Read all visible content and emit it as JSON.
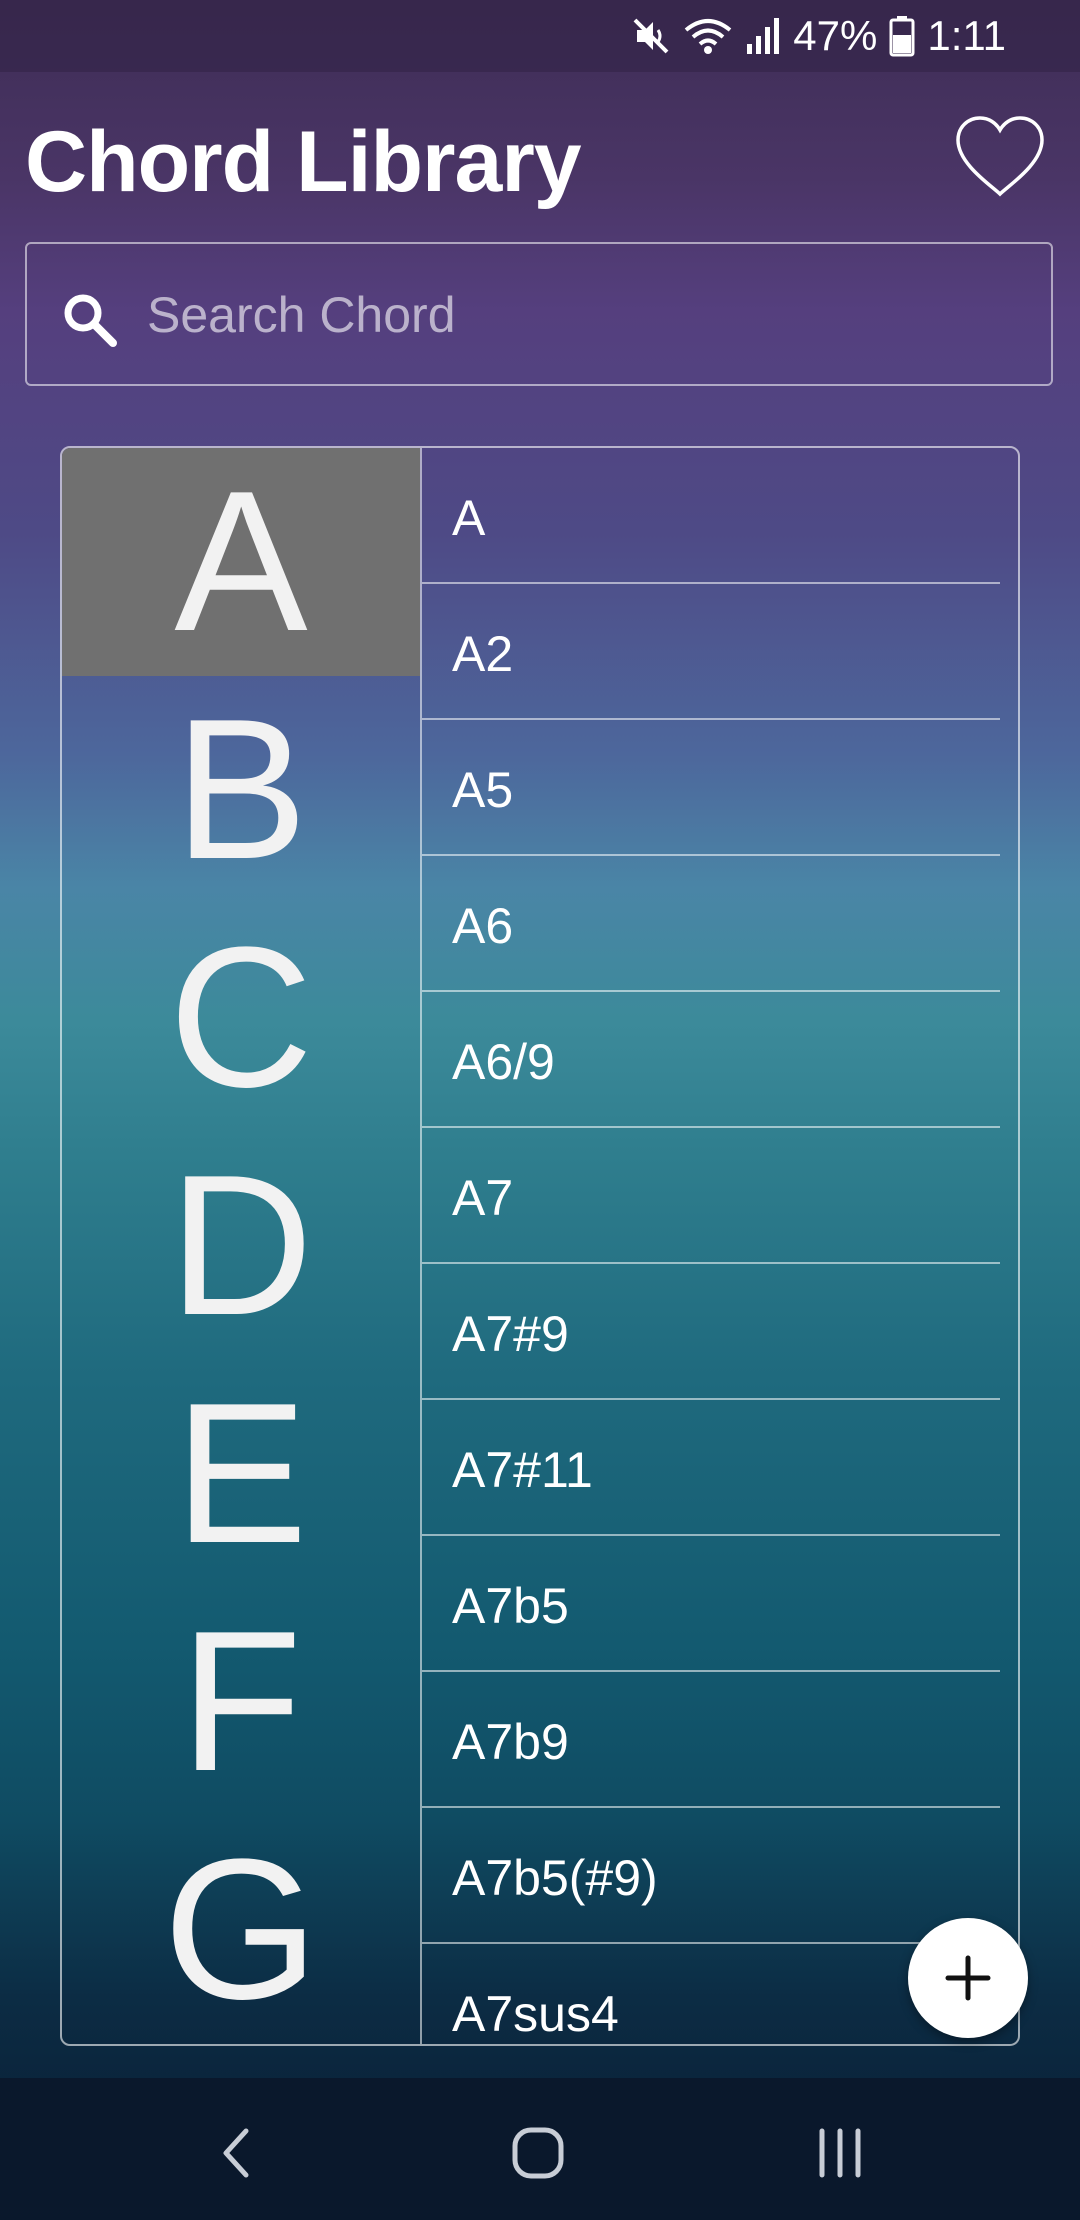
{
  "status_bar": {
    "battery_percent": "47%",
    "time": "1:11",
    "icons": [
      "mute-icon",
      "wifi-icon",
      "signal-icon",
      "battery-icon"
    ]
  },
  "header": {
    "title": "Chord Library",
    "favorites_icon": "heart-outline-icon"
  },
  "search": {
    "placeholder": "Search Chord",
    "value": "",
    "icon": "search-icon"
  },
  "letters": {
    "selected": "A",
    "items": [
      "A",
      "B",
      "C",
      "D",
      "E",
      "F",
      "G"
    ]
  },
  "chords": {
    "items": [
      "A",
      "A2",
      "A5",
      "A6",
      "A6/9",
      "A7",
      "A7#9",
      "A7#11",
      "A7b5",
      "A7b9",
      "A7b5(#9)",
      "A7sus4"
    ]
  },
  "fab": {
    "icon": "plus-icon"
  },
  "nav_bar": {
    "icons": [
      "back-icon",
      "home-icon",
      "recents-icon"
    ]
  },
  "colors": {
    "selected_letter_bg": "#707070",
    "divider": "#ffffff",
    "fab_bg": "#ffffff",
    "nav_bg": "#0a182c"
  }
}
